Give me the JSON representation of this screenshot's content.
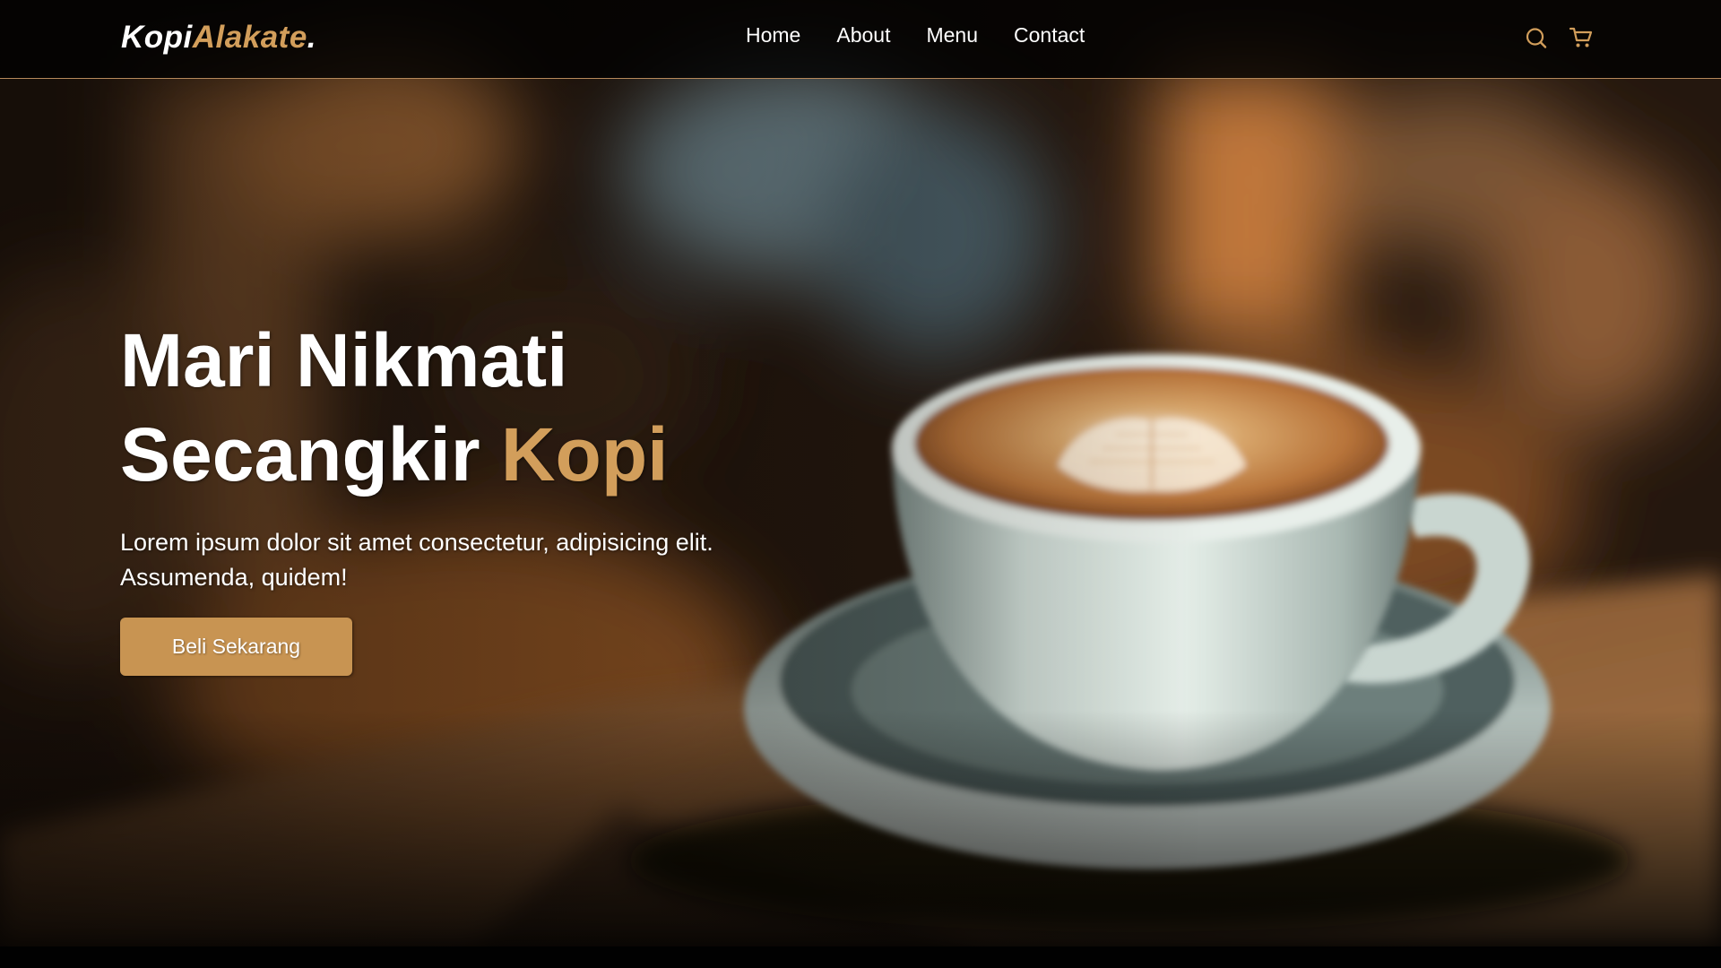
{
  "brand": {
    "name_part1": "Kopi",
    "name_part2": "Alakate",
    "name_dot": "."
  },
  "nav": {
    "links": [
      "Home",
      "About",
      "Menu",
      "Contact"
    ],
    "icons": [
      "search-icon",
      "shopping-cart-icon"
    ]
  },
  "hero": {
    "title_line1": "Mari Nikmati",
    "title_line2_prefix": "Secangkir ",
    "title_line2_accent": "Kopi",
    "description": "Lorem ipsum dolor sit amet consectetur, adipisicing elit. Assumenda, quidem!",
    "cta_label": "Beli Sekarang",
    "background_subject": "coffee-cup-latte-art"
  },
  "colors": {
    "accent": "#d29e5b",
    "button": "#c89452",
    "navbar": "#010101",
    "text": "#ffffff"
  }
}
